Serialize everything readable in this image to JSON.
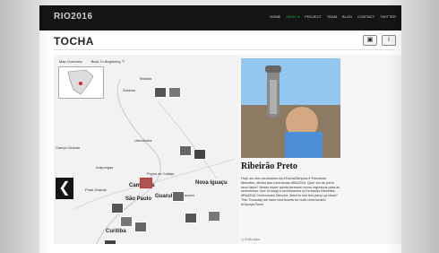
{
  "header": {
    "logo": "RIO2016",
    "nav": [
      "HOME",
      "MENU ▾",
      "PROJECT",
      "TEAM",
      "BLOG",
      "CONTACT",
      "TWITTER"
    ],
    "active_index": 1
  },
  "page": {
    "title": "TOCHA"
  },
  "toolbar": {
    "image_icon": "▣",
    "info_icon": "i"
  },
  "map": {
    "overview": "Map Overview",
    "back": "Back To Beginning ↰",
    "left_arrow": "❮",
    "cities": {
      "brasilia": "Brasilia",
      "goiania": "Goiânia",
      "uberlandia": "Uberlândia",
      "campinas": "Campinas",
      "guarulhos": "Guarulhos",
      "sao_paulo": "São Paulo",
      "curitiba": "Curitiba",
      "nova_iguacu": "Nova Iguaçu",
      "ribeirao_preto": "Ribeirão Preto",
      "jacarei": "Jacareí",
      "praia_grande": "Praia Grande",
      "pocos": "Poços de Caldas",
      "arapongas": "Arapongas",
      "campo_grande": "Campo Grande"
    }
  },
  "panel": {
    "title": "Ribeirão Preto",
    "text": "Hoje um dos condutores da #TochaOlimpica é Fernando Meirelles, diretor das cerimônias #Rio2016. Quer ver de perto seus fatos? Nesse super quinta teremos novos ingressos para as cerimônias! One of today's torchbearers is Fernando Meirelles, #Rio2016 Ceremonies Director. Want to see this party up close? This Thursday we have new tickets for both ceremonies! #OlympicTorch",
    "footer": "◷ 6195 Likes"
  }
}
